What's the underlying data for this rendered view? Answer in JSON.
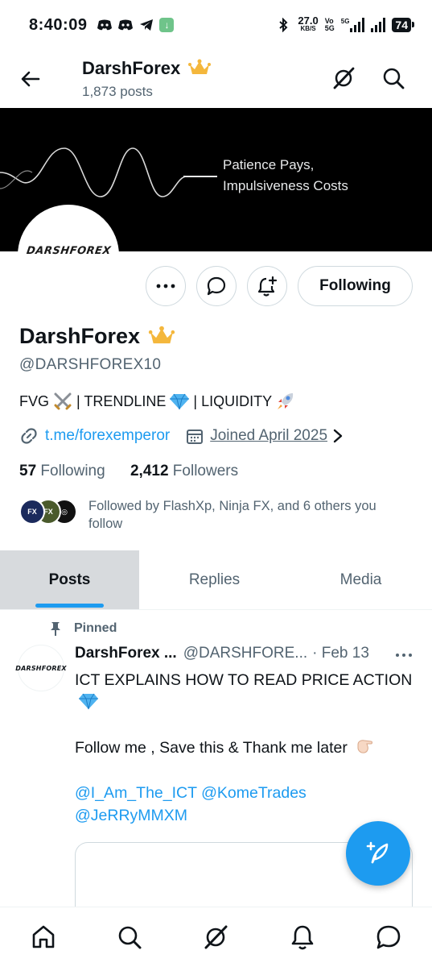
{
  "status_bar": {
    "time": "8:40:09",
    "net_speed": "27.0",
    "net_unit": "KB/S",
    "volte_top": "Vo",
    "volte_bottom": "5G",
    "network": "5G",
    "battery": "74"
  },
  "header": {
    "title": "DarshForex",
    "post_count": "1,873 posts"
  },
  "banner": {
    "line1": "Patience Pays,",
    "line2": "Impulsiveness Costs"
  },
  "avatar": {
    "logo_text": "DARSHFOREX"
  },
  "actions": {
    "following_label": "Following"
  },
  "profile": {
    "name": "DarshForex",
    "handle": "@DARSHFOREX10",
    "bio_1": "FVG",
    "bio_2": "| TRENDLINE",
    "bio_3": "| LIQUIDITY",
    "link": "t.me/forexemperor",
    "joined": "Joined April 2025",
    "following_count": "57",
    "following_label": "Following",
    "followers_count": "2,412",
    "followers_label": "Followers",
    "followed_by": "Followed by FlashXp, Ninja FX, and 6 others you follow"
  },
  "tabs": [
    {
      "label": "Posts"
    },
    {
      "label": "Replies"
    },
    {
      "label": "Media"
    }
  ],
  "post": {
    "pinned_label": "Pinned",
    "avatar_text": "DARSHFOREX",
    "author": "DarshForex ...",
    "handle": "@DARSHFORE...",
    "date": "· Feb 13",
    "more": "•••",
    "line1": "ICT EXPLAINS HOW TO READ PRICE ACTION",
    "line2": "Follow me , Save this & Thank me later",
    "mention1": "@I_Am_The_ICT",
    "mention2": "@KomeTrades",
    "mention3": "@JeRRyMMXM"
  },
  "colors": {
    "accent": "#1d9bf0",
    "text": "#0f1419",
    "muted": "#536471",
    "crown": "#f4b73c"
  }
}
